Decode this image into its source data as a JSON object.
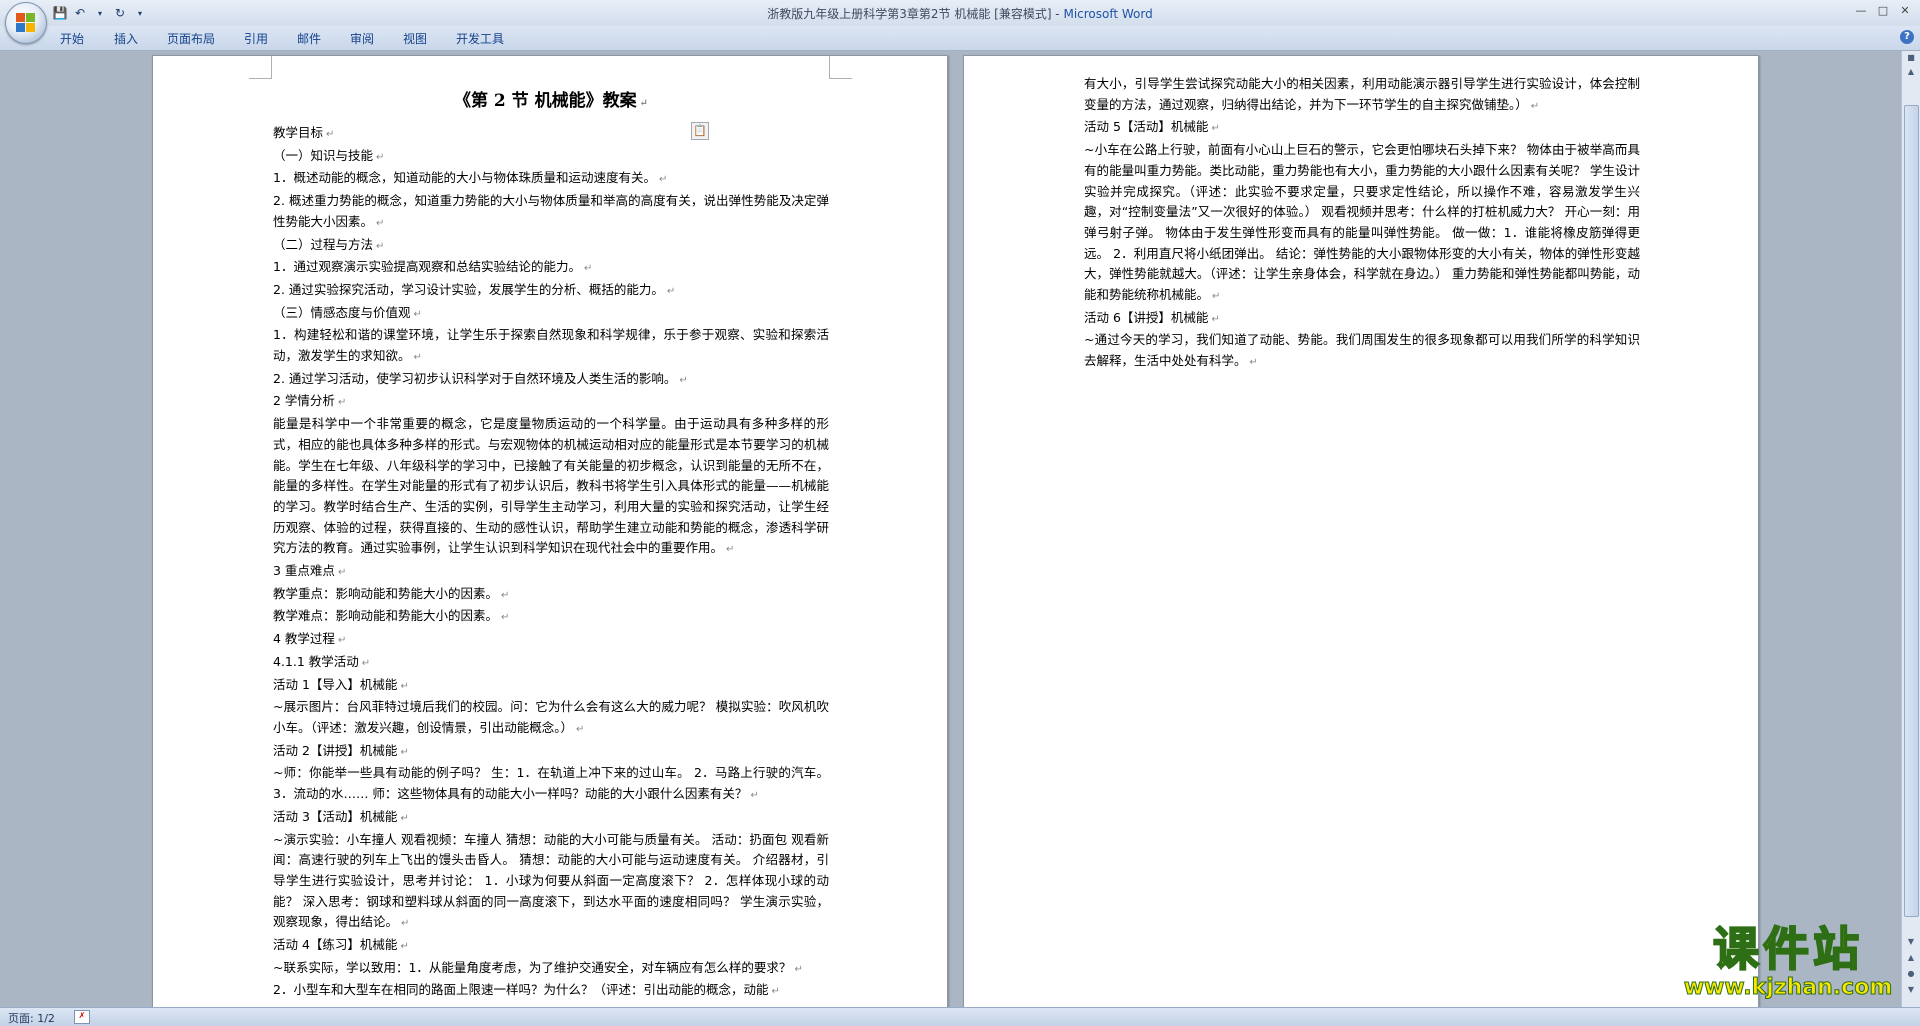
{
  "window": {
    "title": "浙教版九年级上册科学第3章第2节 机械能 [兼容模式] - ",
    "app_name": "Microsoft Word"
  },
  "ribbon": {
    "tabs": [
      "开始",
      "插入",
      "页面布局",
      "引用",
      "邮件",
      "审阅",
      "视图",
      "开发工具"
    ]
  },
  "document": {
    "page1": {
      "title": "《第 2 节  机械能》教案",
      "lines": [
        "教学目标",
        "（一）知识与技能",
        "1．概述动能的概念，知道动能的大小与物体珠质量和运动速度有关。",
        "2. 概述重力势能的概念，知道重力势能的大小与物体质量和举高的高度有关，说出弹性势能及决定弹性势能大小因素。",
        "（二）过程与方法",
        "1．通过观察演示实验提高观察和总结实验结论的能力。",
        "2. 通过实验探究活动，学习设计实验，发展学生的分析、概括的能力。",
        "（三）情感态度与价值观",
        "1．构建轻松和谐的课堂环境，让学生乐于探索自然现象和科学规律，乐于参于观察、实验和探索活动，激发学生的求知欲。",
        "2. 通过学习活动，使学习初步认识科学对于自然环境及人类生活的影响。",
        "2 学情分析",
        "能量是科学中一个非常重要的概念，它是度量物质运动的一个科学量。由于运动具有多种多样的形式，相应的能也具体多种多样的形式。与宏观物体的机械运动相对应的能量形式是本节要学习的机械能。学生在七年级、八年级科学的学习中，已接触了有关能量的初步概念，认识到能量的无所不在，能量的多样性。在学生对能量的形式有了初步认识后，教科书将学生引入具体形式的能量——机械能的学习。教学时结合生产、生活的实例，引导学生主动学习，利用大量的实验和探究活动，让学生经历观察、体验的过程，获得直接的、生动的感性认识，帮助学生建立动能和势能的概念，渗透科学研究方法的教育。通过实验事例，让学生认识到科学知识在现代社会中的重要作用。",
        "3 重点难点",
        "教学重点：影响动能和势能大小的因素。",
        "教学难点：影响动能和势能大小的因素。",
        "4 教学过程",
        "4.1.1 教学活动",
        "活动 1【导入】机械能",
        "~展示图片：台风菲特过境后我们的校园。问：它为什么会有这么大的威力呢？  模拟实验：吹风机吹小车。（评述：激发兴趣，创设情景，引出动能概念。）",
        "活动 2【讲授】机械能",
        "~师：你能举一些具有动能的例子吗？  生：1．在轨道上冲下来的过山车。  2．马路上行驶的汽车。  3．流动的水……  师：这些物体具有的动能大小一样吗？动能的大小跟什么因素有关？",
        "活动 3【活动】机械能",
        "~演示实验：小车撞人  观看视频：车撞人  猜想：动能的大小可能与质量有关。  活动：扔面包  观看新闻：高速行驶的列车上飞出的馒头击昏人。  猜想：动能的大小可能与运动速度有关。  介绍器材，引导学生进行实验设计，思考并讨论：  1．小球为何要从斜面一定高度滚下？  2．怎样体现小球的动能？  深入思考：钢球和塑料球从斜面的同一高度滚下，到达水平面的速度相同吗？  学生演示实验，观察现象，得出结论。",
        "活动 4【练习】机械能",
        "~联系实际，学以致用：1．从能量角度考虑，为了维护交通安全，对车辆应有怎么样的要求？",
        "2．小型车和大型车在相同的路面上限速一样吗？为什么？（评述：引出动能的概念，动能"
      ]
    },
    "page2": {
      "lines": [
        "有大小，引导学生尝试探究动能大小的相关因素，利用动能演示器引导学生进行实验设计，体会控制变量的方法，通过观察，归纳得出结论，并为下一环节学生的自主探究做铺垫。）",
        "活动 5【活动】机械能",
        "~小车在公路上行驶，前面有小心山上巨石的警示，它会更怕哪块石头掉下来？  物体由于被举高而具有的能量叫重力势能。类比动能，重力势能也有大小，重力势能的大小跟什么因素有关呢？  学生设计实验并完成探究。（评述：此实验不要求定量，只要求定性结论，所以操作不难，容易激发学生兴趣，对“控制变量法”又一次很好的体验。）  观看视频并思考：什么样的打桩机威力大？  开心一刻：用弹弓射子弹。  物体由于发生弹性形变而具有的能量叫弹性势能。  做一做：1．谁能将橡皮筋弹得更远。  2．利用直尺将小纸团弹出。  结论：弹性势能的大小跟物体形变的大小有关，物体的弹性形变越大，弹性势能就越大。（评述：让学生亲身体会，科学就在身边。）  重力势能和弹性势能都叫势能，动能和势能统称机械能。",
        "活动 6【讲授】机械能",
        "~通过今天的学习，我们知道了动能、势能。我们周围发生的很多现象都可以用我们所学的科学知识去解释，生活中处处有科学。"
      ]
    }
  },
  "statusbar": {
    "page_info": "页面: 1/2"
  },
  "watermark": {
    "main": "课件站",
    "url": "www.kjzhan.com"
  },
  "icons": {
    "office": "office-button-icon",
    "save": "save-icon",
    "undo": "undo-icon",
    "redo": "redo-icon",
    "help": "help-icon",
    "paste_options": "paste-options-icon"
  }
}
